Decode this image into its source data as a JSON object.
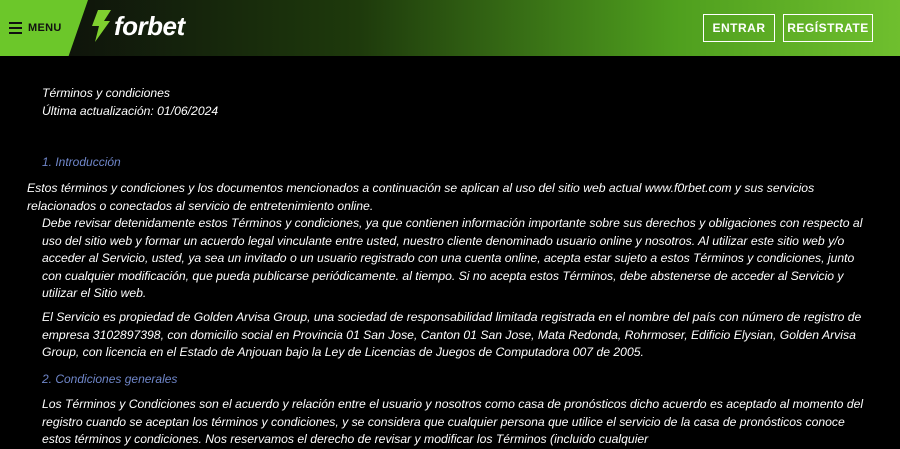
{
  "header": {
    "menu_label": "MENU",
    "logo_text": "forbet",
    "login_label": "ENTRAR",
    "register_label": "REGÍSTRATE",
    "accent_color": "#6cc72a"
  },
  "document": {
    "title": "Términos y condiciones",
    "updated": "Última actualización: 01/06/2024",
    "section1": "1. Introducción",
    "p1": "Estos términos y condiciones y los documentos mencionados a continuación se aplican al uso del sitio web actual www.f0rbet.com y sus servicios relacionados o conectados al servicio de entretenimiento online.",
    "p2": "Debe revisar detenidamente estos Términos y condiciones, ya que contienen información importante sobre sus derechos y obligaciones con respecto al uso del sitio web y formar un acuerdo legal vinculante entre usted, nuestro cliente denominado usuario online y nosotros. Al utilizar este sitio web y/o acceder al Servicio, usted, ya sea un invitado o un usuario registrado con una cuenta online, acepta estar sujeto a estos Términos y condiciones, junto con cualquier modificación, que pueda publicarse periódicamente. al tiempo. Si no acepta estos Términos, debe abstenerse de acceder al Servicio y utilizar el Sitio web.",
    "p3": "El Servicio es propiedad de Golden Arvisa Group, una sociedad de responsabilidad limitada registrada en el nombre del país con número de registro de empresa 3102897398, con domicilio social en Provincia 01 San Jose, Canton 01 San Jose, Mata Redonda, Rohrmoser, Edificio Elysian, Golden Arvisa Group, con licencia en el Estado de Anjouan bajo la Ley de Licencias de Juegos de Computadora 007 de 2005.",
    "section2": "2. Condiciones generales",
    "p4": "Los Términos y Condiciones son el acuerdo y relación entre el usuario y nosotros como casa de pronósticos dicho acuerdo es aceptado al momento del registro cuando se aceptan los términos y condiciones, y se considera que cualquier persona que utilice el servicio de la casa de pronósticos conoce estos términos y condiciones. Nos reservamos el derecho de revisar y modificar los Términos (incluido cualquier"
  }
}
